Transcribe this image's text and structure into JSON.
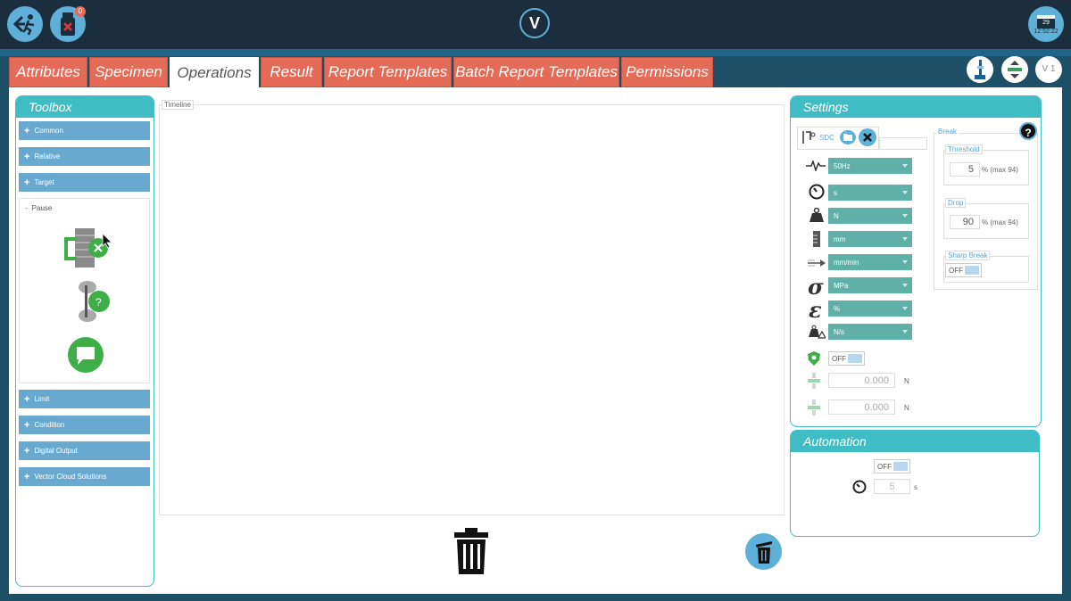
{
  "topbar": {
    "exit_icon": "exit-run-icon",
    "usb_badge": "0",
    "logo_letter": "V",
    "calendar_day": "29",
    "time": "12:52:22"
  },
  "tabs": [
    {
      "label": "Attributes",
      "active": false
    },
    {
      "label": "Specimen",
      "active": false
    },
    {
      "label": "Operations",
      "active": true
    },
    {
      "label": "Result",
      "active": false
    },
    {
      "label": "Report Templates",
      "active": false
    },
    {
      "label": "Batch Report Templates",
      "active": false
    },
    {
      "label": "Permissions",
      "active": false
    }
  ],
  "right_buttons": {
    "version": "V 1"
  },
  "toolbox": {
    "title": "Toolbox",
    "categories_top": [
      "Common",
      "Relative",
      "Target"
    ],
    "expanded": {
      "label": "Pause",
      "sign": "-"
    },
    "categories_bottom": [
      "Limit",
      "Condition",
      "Digital Output",
      "Vector Cloud Solutions"
    ]
  },
  "timeline": {
    "label": "Timeline"
  },
  "settings": {
    "title": "Settings",
    "sdc_label": "SDC",
    "rows": [
      {
        "icon": "frequency-icon",
        "value": "50Hz"
      },
      {
        "icon": "timer-icon",
        "value": "s"
      },
      {
        "icon": "weight-icon",
        "value": "N"
      },
      {
        "icon": "length-icon",
        "value": "mm"
      },
      {
        "icon": "speed-icon",
        "value": "mm/min"
      },
      {
        "icon": "sigma-icon",
        "value": "MPa"
      },
      {
        "icon": "epsilon-icon",
        "value": "%"
      },
      {
        "icon": "rate-icon",
        "value": "N/s"
      }
    ],
    "protect_toggle": "OFF",
    "force_fields": [
      {
        "value": "0.000",
        "unit": "N"
      },
      {
        "value": "0.000",
        "unit": "N"
      }
    ],
    "break": {
      "title": "Break",
      "help": "?",
      "threshold": {
        "label": "Threshold",
        "value": "5",
        "suffix": "% (max 94)"
      },
      "drop": {
        "label": "Drop",
        "value": "90",
        "suffix": "% (max 94)"
      },
      "sharp_break": {
        "label": "Sharp Break",
        "toggle": "OFF"
      }
    }
  },
  "automation": {
    "title": "Automation",
    "toggle": "OFF",
    "delay_value": "5",
    "delay_unit": "s"
  },
  "colors": {
    "header": "#1b2e3d",
    "accent_teal": "#3fbcc4",
    "tab_orange": "#e46b58",
    "category_blue": "#6aa9cf",
    "select_green": "#5fb0a7"
  }
}
